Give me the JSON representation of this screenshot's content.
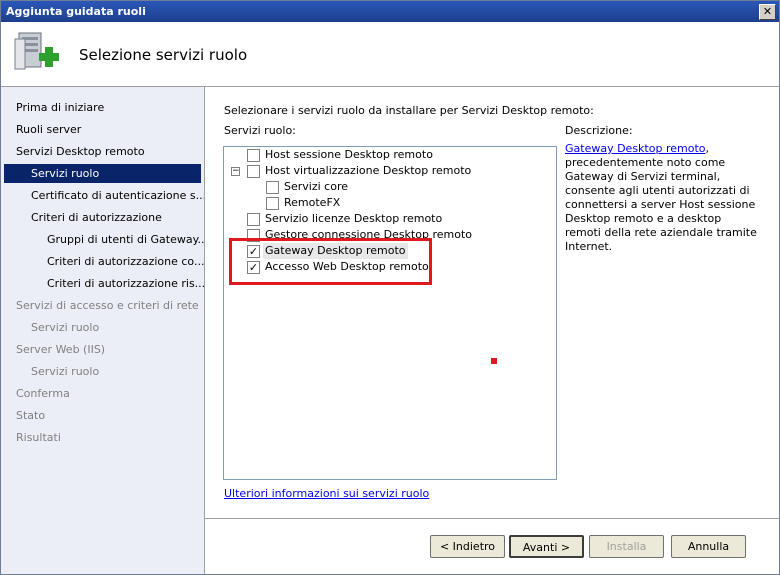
{
  "window": {
    "title": "Aggiunta guidata ruoli",
    "close_label": "✕"
  },
  "header": {
    "title": "Selezione servizi ruolo"
  },
  "sidebar": {
    "items": [
      {
        "label": "Prima di iniziare",
        "state": "enabled"
      },
      {
        "label": "Ruoli server",
        "state": "enabled"
      },
      {
        "label": "Servizi Desktop remoto",
        "state": "enabled"
      },
      {
        "label": "Servizi ruolo",
        "state": "selected"
      },
      {
        "label": "Certificato di autenticazione s...",
        "state": "enabled"
      },
      {
        "label": "Criteri di autorizzazione",
        "state": "enabled"
      },
      {
        "label": "Gruppi di utenti di Gateway...",
        "state": "enabled"
      },
      {
        "label": "Criteri di autorizzazione co...",
        "state": "enabled"
      },
      {
        "label": "Criteri di autorizzazione ris...",
        "state": "enabled"
      },
      {
        "label": "Servizi di accesso e criteri di rete",
        "state": "disabled"
      },
      {
        "label": "Servizi ruolo",
        "state": "disabled"
      },
      {
        "label": "Server Web (IIS)",
        "state": "disabled"
      },
      {
        "label": "Servizi ruolo",
        "state": "disabled"
      },
      {
        "label": "Conferma",
        "state": "disabled"
      },
      {
        "label": "Stato",
        "state": "disabled"
      },
      {
        "label": "Risultati",
        "state": "disabled"
      }
    ]
  },
  "main": {
    "instruction": "Selezionare i servizi ruolo da installare per Servizi Desktop remoto:",
    "services_label": "Servizi ruolo:",
    "services": [
      {
        "label": "Host sessione Desktop remoto",
        "checked": false
      },
      {
        "label": "Host virtualizzazione Desktop remoto",
        "checked": false,
        "expander": "−"
      },
      {
        "label": "Servizi core",
        "checked": false
      },
      {
        "label": "RemoteFX",
        "checked": false
      },
      {
        "label": "Servizio licenze Desktop remoto",
        "checked": false
      },
      {
        "label": "Gestore connessione Desktop remoto",
        "checked": false
      },
      {
        "label": "Gateway Desktop remoto",
        "checked": true
      },
      {
        "label": "Accesso Web Desktop remoto",
        "checked": true
      }
    ],
    "description_label": "Descrizione:",
    "description_link": "Gateway Desktop remoto",
    "description_text": ", precedentemente noto come Gateway di Servizi terminal, consente agli utenti autorizzati di connettersi a server Host sessione Desktop remoto e a desktop remoti della rete aziendale tramite Internet.",
    "more_info_link": "Ulteriori informazioni sui servizi ruolo"
  },
  "buttons": {
    "back": "< Indietro",
    "next": "Avanti >",
    "install": "Installa",
    "cancel": "Annulla"
  },
  "colors": {
    "highlight": "#e01820",
    "selection": "#0a246a",
    "link": "#0000ee"
  }
}
